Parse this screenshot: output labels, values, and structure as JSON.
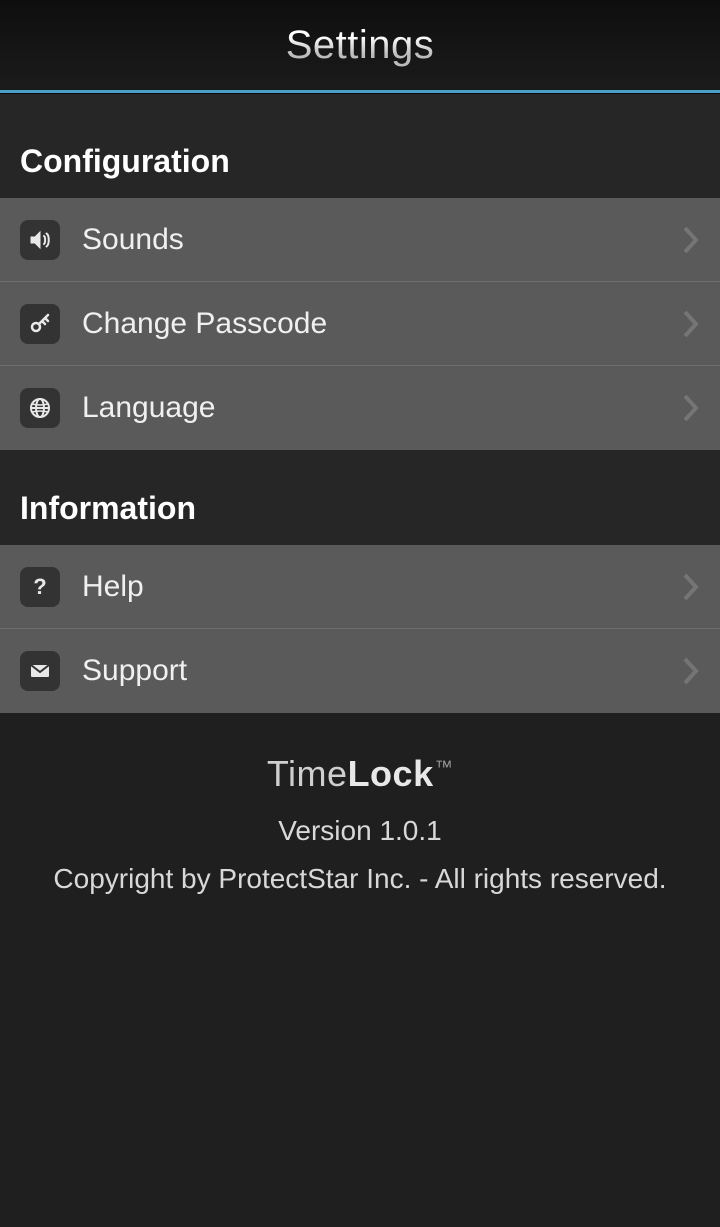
{
  "header": {
    "title": "Settings"
  },
  "sections": {
    "configuration": {
      "title": "Configuration",
      "items": {
        "sounds": {
          "label": "Sounds"
        },
        "passcode": {
          "label": "Change Passcode"
        },
        "language": {
          "label": "Language"
        }
      }
    },
    "information": {
      "title": "Information",
      "items": {
        "help": {
          "label": "Help"
        },
        "support": {
          "label": "Support"
        }
      }
    }
  },
  "footer": {
    "logo_thin": "Time",
    "logo_bold": "Lock",
    "logo_tm": "™",
    "version": "Version 1.0.1",
    "copyright": "Copyright by ProtectStar Inc. - All rights reserved."
  }
}
